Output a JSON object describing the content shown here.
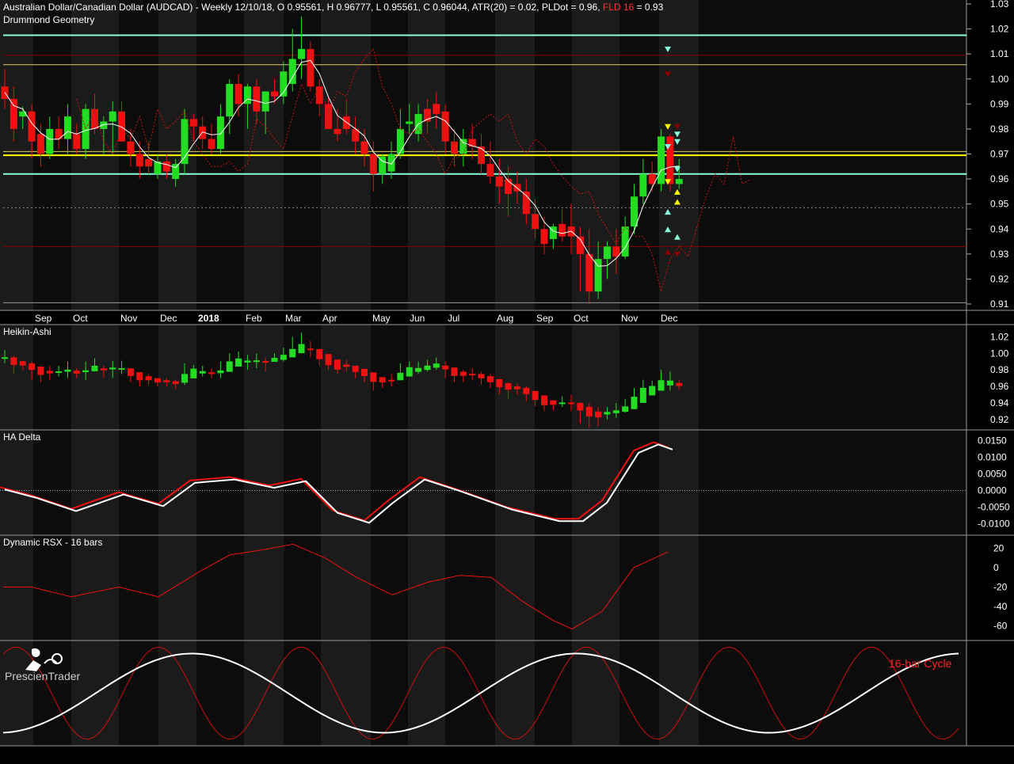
{
  "header": {
    "title": "Australian Dollar/Canadian Dollar (AUDCAD) - Weekly 12/10/18, O 0.95561, H 0.96777, L 0.95561, C 0.96044, ATR(20) = 0.02, PLDot = 0.96, ",
    "fld_label": "FLD 16",
    "fld_value": " = 0.93"
  },
  "colors": {
    "bull": "#22dd22",
    "bear": "#ee1111",
    "cyan": "#88ffdd",
    "yellow": "#ffff00",
    "darkred": "#8b0000",
    "white": "#ffffff"
  },
  "panes": {
    "main": {
      "title": "Drummond Geometry",
      "yticks": [
        "1.03",
        "1.02",
        "1.01",
        "1.00",
        "0.99",
        "0.98",
        "0.97",
        "0.96",
        "0.95",
        "0.94",
        "0.93",
        "0.92",
        "0.91"
      ]
    },
    "ha": {
      "title": "Heikin-Ashi",
      "yticks": [
        "1.02",
        "1.00",
        "0.98",
        "0.96",
        "0.94",
        "0.92"
      ]
    },
    "delta": {
      "title": "HA Delta",
      "yticks": [
        "0.0150",
        "0.0100",
        "0.0050",
        "0.0000",
        "-0.0050",
        "-0.0100"
      ]
    },
    "rsx": {
      "title": "Dynamic RSX - 16 bars",
      "yticks": [
        "20",
        "0",
        "-20",
        "-40",
        "-60"
      ]
    },
    "cycle": {
      "label": "16-bar Cycle"
    }
  },
  "brand": {
    "name": "PrescienTrader"
  },
  "x_axis": {
    "months": [
      "Sep",
      "Oct",
      "Nov",
      "Dec",
      "2018",
      "Feb",
      "Mar",
      "Apr",
      "May",
      "Jun",
      "Jul",
      "Aug",
      "Sep",
      "Oct",
      "Nov",
      "Dec"
    ]
  },
  "chart_data": {
    "type": "candlestick",
    "series_name": "AUDCAD Weekly",
    "ylim": [
      0.905,
      1.03
    ],
    "ohlc": [
      [
        0.997,
        1.004,
        0.988,
        0.992
      ],
      [
        0.992,
        0.997,
        0.975,
        0.98
      ],
      [
        0.985,
        0.989,
        0.98,
        0.987
      ],
      [
        0.987,
        0.99,
        0.968,
        0.975
      ],
      [
        0.978,
        0.982,
        0.965,
        0.97
      ],
      [
        0.97,
        0.985,
        0.968,
        0.98
      ],
      [
        0.98,
        0.985,
        0.972,
        0.976
      ],
      [
        0.976,
        0.99,
        0.97,
        0.985
      ],
      [
        0.978,
        0.982,
        0.97,
        0.972
      ],
      [
        0.972,
        0.99,
        0.968,
        0.988
      ],
      [
        0.988,
        0.994,
        0.978,
        0.98
      ],
      [
        0.98,
        0.985,
        0.97,
        0.983
      ],
      [
        0.983,
        0.991,
        0.97,
        0.987
      ],
      [
        0.987,
        0.991,
        0.975,
        0.975
      ],
      [
        0.975,
        0.98,
        0.965,
        0.97
      ],
      [
        0.97,
        0.975,
        0.96,
        0.965
      ],
      [
        0.968,
        0.975,
        0.962,
        0.965
      ],
      [
        0.962,
        0.97,
        0.96,
        0.967
      ],
      [
        0.967,
        0.97,
        0.96,
        0.963
      ],
      [
        0.96,
        0.968,
        0.957,
        0.966
      ],
      [
        0.966,
        0.988,
        0.962,
        0.984
      ],
      [
        0.984,
        0.986,
        0.975,
        0.981
      ],
      [
        0.981,
        0.985,
        0.972,
        0.976
      ],
      [
        0.976,
        0.982,
        0.97,
        0.972
      ],
      [
        0.972,
        0.99,
        0.97,
        0.985
      ],
      [
        0.985,
        1.0,
        0.978,
        0.998
      ],
      [
        0.998,
        1.002,
        0.985,
        0.99
      ],
      [
        0.99,
        0.998,
        0.98,
        0.997
      ],
      [
        0.997,
        1.0,
        0.982,
        0.987
      ],
      [
        0.987,
        0.995,
        0.978,
        0.995
      ],
      [
        0.995,
        1.0,
        0.99,
        0.993
      ],
      [
        0.993,
        1.007,
        0.99,
        1.003
      ],
      [
        0.998,
        1.02,
        0.995,
        1.008
      ],
      [
        1.008,
        1.025,
        1.0,
        1.012
      ],
      [
        1.012,
        1.015,
        0.995,
        0.997
      ],
      [
        0.997,
        1.0,
        0.985,
        0.99
      ],
      [
        0.99,
        0.993,
        0.98,
        0.98
      ],
      [
        0.98,
        0.988,
        0.975,
        0.978
      ],
      [
        0.985,
        0.992,
        0.978,
        0.98
      ],
      [
        0.98,
        0.985,
        0.97,
        0.975
      ],
      [
        0.975,
        0.98,
        0.965,
        0.97
      ],
      [
        0.97,
        0.975,
        0.955,
        0.962
      ],
      [
        0.962,
        0.97,
        0.958,
        0.969
      ],
      [
        0.963,
        0.975,
        0.96,
        0.97
      ],
      [
        0.97,
        0.988,
        0.968,
        0.98
      ],
      [
        0.982,
        0.99,
        0.978,
        0.983
      ],
      [
        0.978,
        0.99,
        0.975,
        0.986
      ],
      [
        0.988,
        0.992,
        0.978,
        0.983
      ],
      [
        0.99,
        0.995,
        0.98,
        0.986
      ],
      [
        0.987,
        0.99,
        0.97,
        0.975
      ],
      [
        0.975,
        0.98,
        0.965,
        0.97
      ],
      [
        0.97,
        0.98,
        0.965,
        0.976
      ],
      [
        0.976,
        0.982,
        0.968,
        0.973
      ],
      [
        0.973,
        0.978,
        0.962,
        0.966
      ],
      [
        0.966,
        0.975,
        0.958,
        0.961
      ],
      [
        0.961,
        0.968,
        0.95,
        0.957
      ],
      [
        0.96,
        0.965,
        0.945,
        0.954
      ],
      [
        0.958,
        0.963,
        0.95,
        0.955
      ],
      [
        0.955,
        0.96,
        0.942,
        0.946
      ],
      [
        0.946,
        0.952,
        0.936,
        0.94
      ],
      [
        0.94,
        0.945,
        0.93,
        0.934
      ],
      [
        0.936,
        0.942,
        0.932,
        0.941
      ],
      [
        0.942,
        0.948,
        0.935,
        0.937
      ],
      [
        0.941,
        0.95,
        0.93,
        0.937
      ],
      [
        0.937,
        0.941,
        0.915,
        0.93
      ],
      [
        0.93,
        0.94,
        0.91,
        0.915
      ],
      [
        0.915,
        0.935,
        0.912,
        0.928
      ],
      [
        0.928,
        0.935,
        0.92,
        0.933
      ],
      [
        0.933,
        0.94,
        0.922,
        0.929
      ],
      [
        0.929,
        0.945,
        0.928,
        0.941
      ],
      [
        0.941,
        0.958,
        0.938,
        0.953
      ],
      [
        0.953,
        0.968,
        0.95,
        0.962
      ],
      [
        0.962,
        0.967,
        0.955,
        0.958
      ],
      [
        0.958,
        0.98,
        0.955,
        0.977
      ],
      [
        0.977,
        0.978,
        0.955,
        0.958
      ],
      [
        0.958,
        0.968,
        0.956,
        0.96
      ]
    ],
    "horizontal_lines": [
      {
        "y": 1.0175,
        "color": "cyan"
      },
      {
        "y": 1.0095,
        "color": "darkred"
      },
      {
        "y": 1.0057,
        "color": "yellow-thin"
      },
      {
        "y": 0.971,
        "color": "yellow-thin"
      },
      {
        "y": 0.9695,
        "color": "yellow"
      },
      {
        "y": 0.962,
        "color": "cyan"
      },
      {
        "y": 0.9485,
        "color": "grey-dotted"
      },
      {
        "y": 0.933,
        "color": "darkred"
      },
      {
        "y": 0.9105,
        "color": "white-thin"
      }
    ],
    "ha_delta_ylim": [
      -0.012,
      0.017
    ],
    "rsx_ylim": [
      -70,
      30
    ],
    "cycle_label": "16-bar Cycle"
  }
}
